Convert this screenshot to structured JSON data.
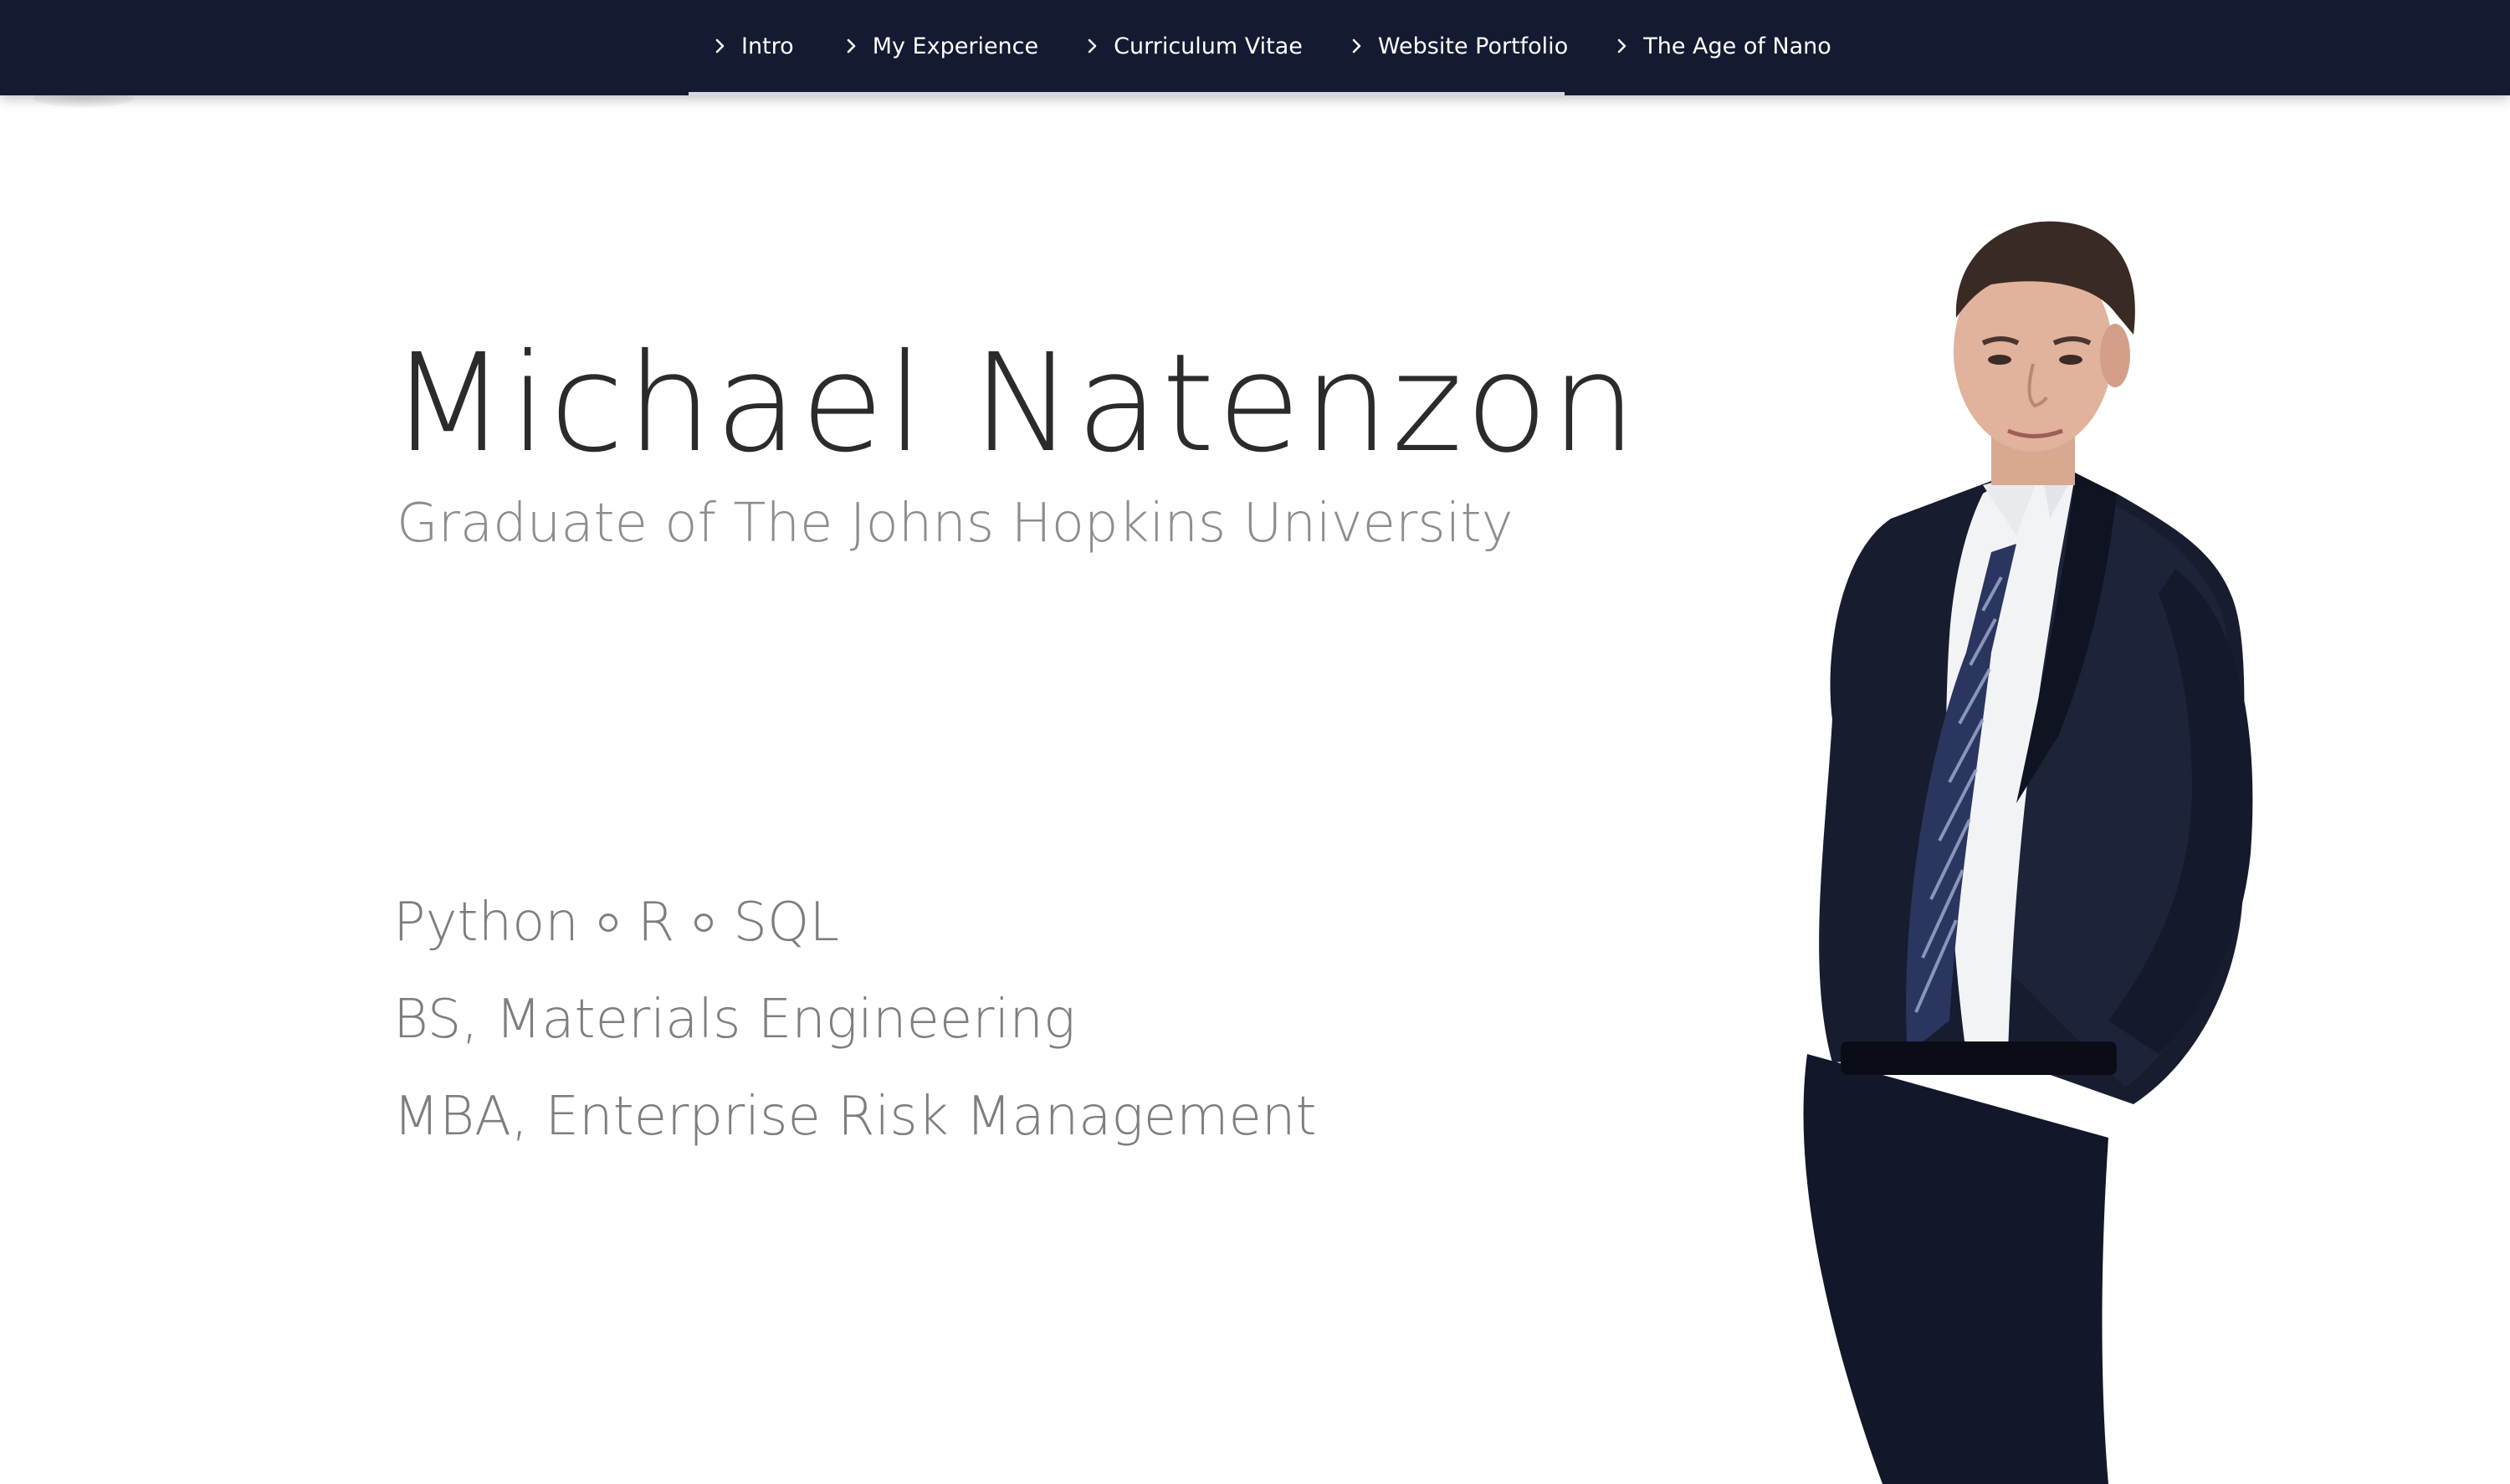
{
  "nav": {
    "items": [
      {
        "label": "Intro",
        "icon": "chevron-right-icon"
      },
      {
        "label": "My Experience",
        "icon": "chevron-right-icon"
      },
      {
        "label": "Curriculum Vitae",
        "icon": "chevron-right-icon"
      },
      {
        "label": "Website Portfolio",
        "icon": "chevron-right-icon"
      },
      {
        "label": "The Age of Nano",
        "icon": "chevron-right-icon"
      }
    ],
    "background": "#141a31"
  },
  "hero": {
    "name": "Michael Natenzon",
    "subtitle": "Graduate of The Johns Hopkins University"
  },
  "skills": {
    "languages": [
      "Python",
      "R",
      "SQL"
    ],
    "degrees": [
      "BS, Materials Engineering",
      "MBA, Enterprise Risk Management"
    ]
  },
  "colors": {
    "name_text": "#2b2b2b",
    "sub_text": "#8d8d8d",
    "suit": "#161b2b"
  }
}
